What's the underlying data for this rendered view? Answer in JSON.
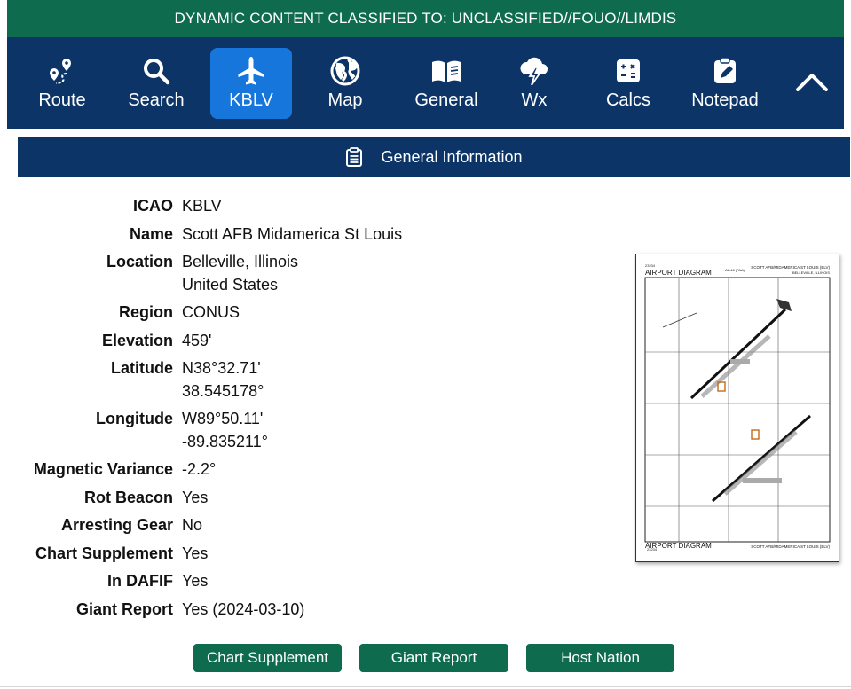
{
  "classification": "DYNAMIC CONTENT CLASSIFIED TO: UNCLASSIFIED//FOUO//LIMDIS",
  "colors": {
    "classification_bg": "#0e6b4e",
    "toolbar_bg": "#0c3466",
    "active_tab": "#1676dc",
    "button_bg": "#0e6b4e"
  },
  "toolbar": {
    "items": [
      {
        "label": "Route",
        "icon": "route-icon"
      },
      {
        "label": "Search",
        "icon": "search-icon"
      },
      {
        "label": "KBLV",
        "icon": "airplane-icon",
        "active": true
      },
      {
        "label": "Map",
        "icon": "globe-icon"
      },
      {
        "label": "General",
        "icon": "book-icon"
      },
      {
        "label": "Wx",
        "icon": "weather-icon"
      },
      {
        "label": "Calcs",
        "icon": "calculator-icon"
      },
      {
        "label": "Notepad",
        "icon": "notepad-icon"
      }
    ],
    "collapse_icon": "chevron-up-icon"
  },
  "section": {
    "title": "General Information",
    "icon": "clipboard-icon"
  },
  "info": [
    {
      "key": "ICAO",
      "lines": [
        "KBLV"
      ]
    },
    {
      "key": "Name",
      "lines": [
        "Scott AFB Midamerica St Louis"
      ]
    },
    {
      "key": "Location",
      "lines": [
        "Belleville, Illinois",
        "United States"
      ]
    },
    {
      "key": "Region",
      "lines": [
        "CONUS"
      ]
    },
    {
      "key": "Elevation",
      "lines": [
        "459'"
      ]
    },
    {
      "key": "Latitude",
      "lines": [
        "N38°32.71'",
        "38.545178°"
      ]
    },
    {
      "key": "Longitude",
      "lines": [
        "W89°50.11'",
        "-89.835211°"
      ]
    },
    {
      "key": "Magnetic Variance",
      "lines": [
        "-2.2°"
      ]
    },
    {
      "key": "Rot Beacon",
      "lines": [
        "Yes"
      ]
    },
    {
      "key": "Arresting Gear",
      "lines": [
        "No"
      ]
    },
    {
      "key": "Chart Supplement",
      "lines": [
        "Yes"
      ]
    },
    {
      "key": "In DAFIF",
      "lines": [
        "Yes"
      ]
    },
    {
      "key": "Giant Report",
      "lines": [
        "Yes (2024-03-10)"
      ]
    }
  ],
  "diagram": {
    "title_top": "AIRPORT DIAGRAM",
    "title_bottom": "AIRPORT DIAGRAM",
    "airport": "SCOTT AFB/MIDAMERICA ST LOUIS (BLV)",
    "city": "BELLEVILLE, ILLINOIS",
    "cycle": "23234",
    "al_code": "AL-46 (FAA)"
  },
  "buttons": {
    "chart_supplement": "Chart Supplement",
    "giant_report": "Giant Report",
    "host_nation": "Host Nation"
  }
}
